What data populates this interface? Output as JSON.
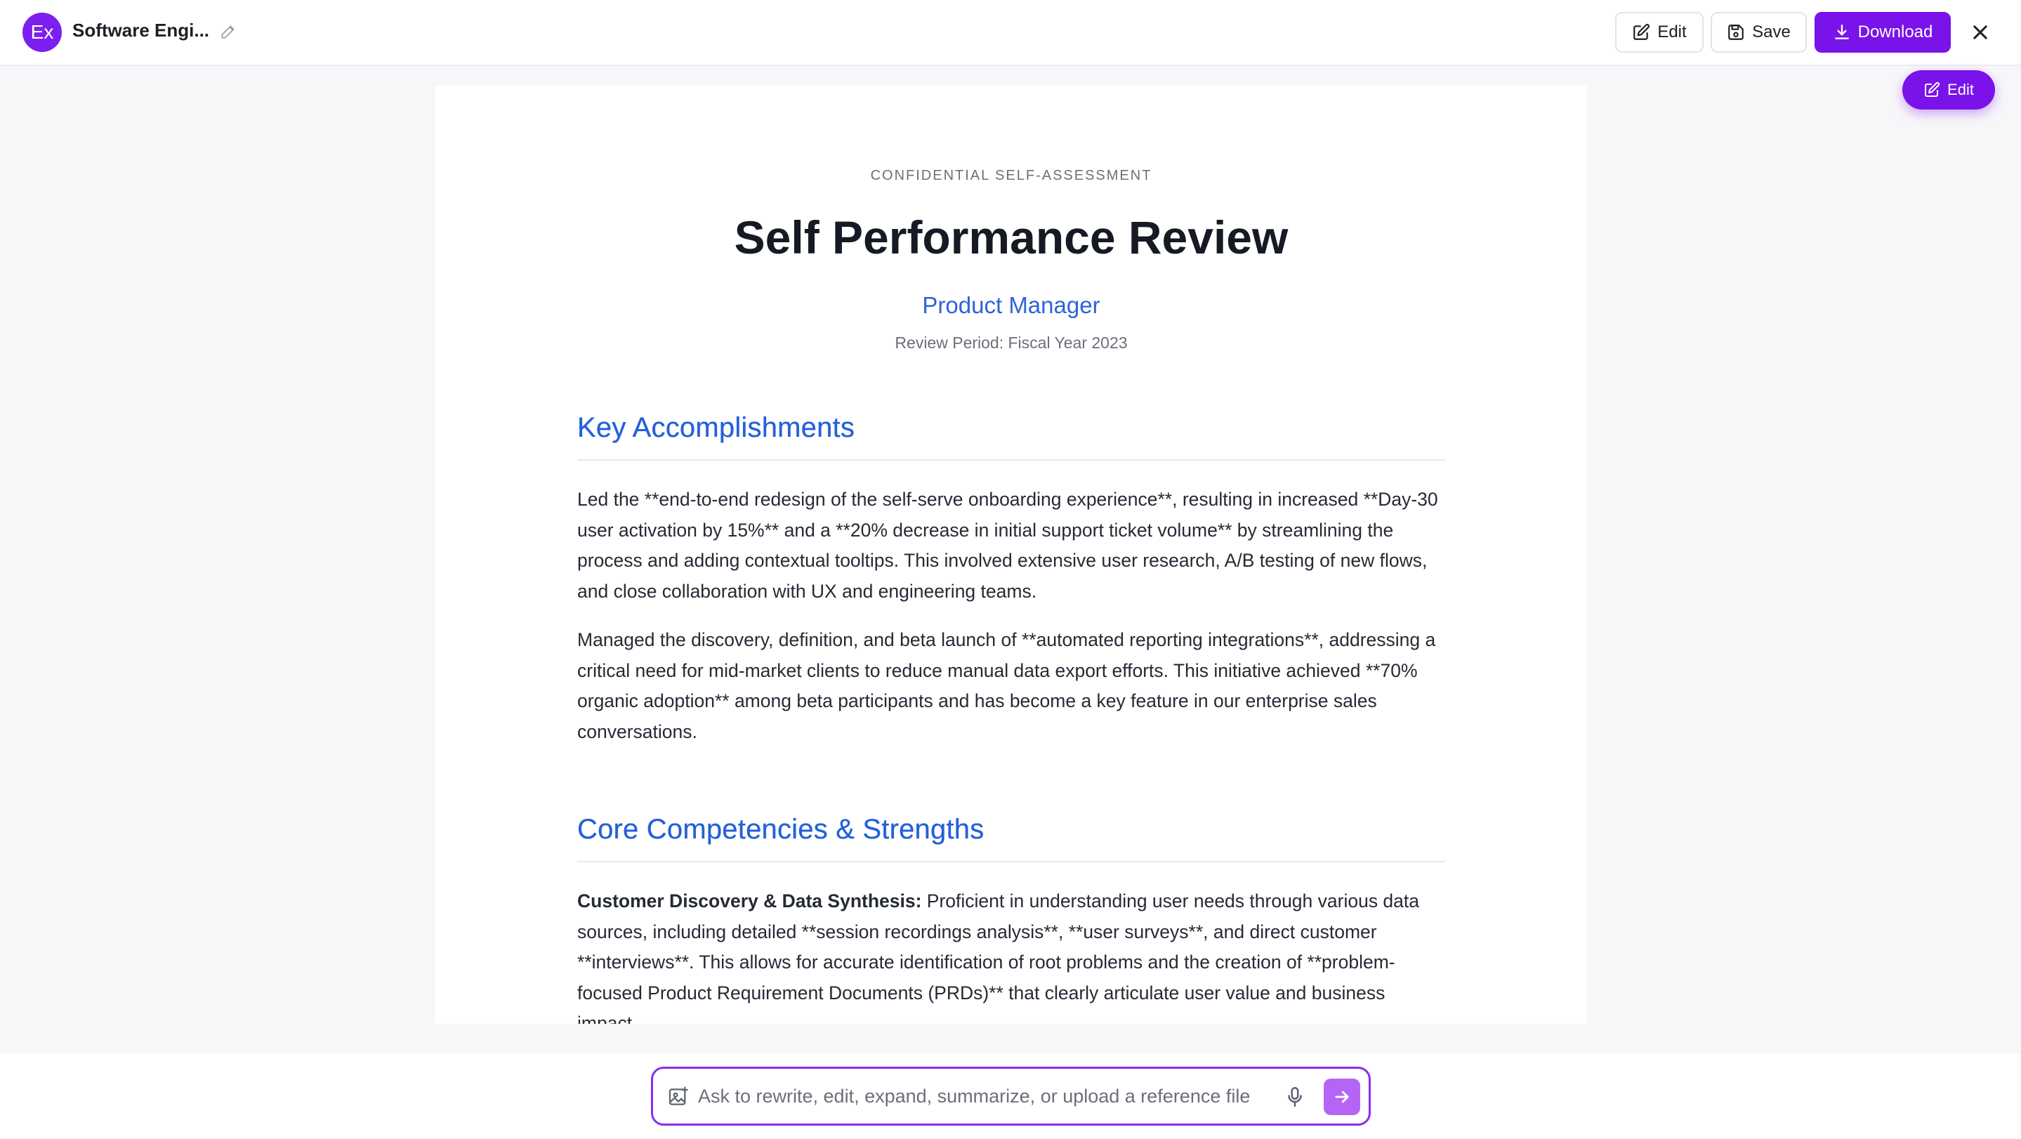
{
  "header": {
    "avatar_text": "Ex",
    "doc_title": "Software Engi...",
    "edit_label": "Edit",
    "save_label": "Save",
    "download_label": "Download",
    "floating_edit_label": "Edit",
    "accent_color": "#7a12ea"
  },
  "document": {
    "eyebrow": "CONFIDENTIAL SELF-ASSESSMENT",
    "title": "Self Performance Review",
    "role": "Product Manager",
    "period": "Review Period: Fiscal Year 2023",
    "sections": [
      {
        "heading": "Key Accomplishments",
        "paragraphs": [
          "Led the **end-to-end redesign of the self-serve onboarding experience**, resulting in increased **Day-30 user activation by 15%** and a **20% decrease in initial support ticket volume** by streamlining the process and adding contextual tooltips. This involved extensive user research, A/B testing of new flows, and close collaboration with UX and engineering teams.",
          "Managed the discovery, definition, and beta launch of **automated reporting integrations**, addressing a critical need for mid-market clients to reduce manual data export efforts. This initiative achieved **70% organic adoption** among beta participants and has become a key feature in our enterprise sales conversations."
        ]
      },
      {
        "heading": "Core Competencies & Strengths",
        "competency_label": "Customer Discovery & Data Synthesis:",
        "competency_text": " Proficient in understanding user needs through various data sources, including detailed **session recordings analysis**, **user surveys**, and direct customer **interviews**. This allows for accurate identification of root problems and the creation of **problem-focused Product Requirement Documents (PRDs)** that clearly articulate user value and business impact."
      }
    ]
  },
  "composer": {
    "placeholder": "Ask to rewrite, edit, expand, summarize, or upload a reference file"
  }
}
